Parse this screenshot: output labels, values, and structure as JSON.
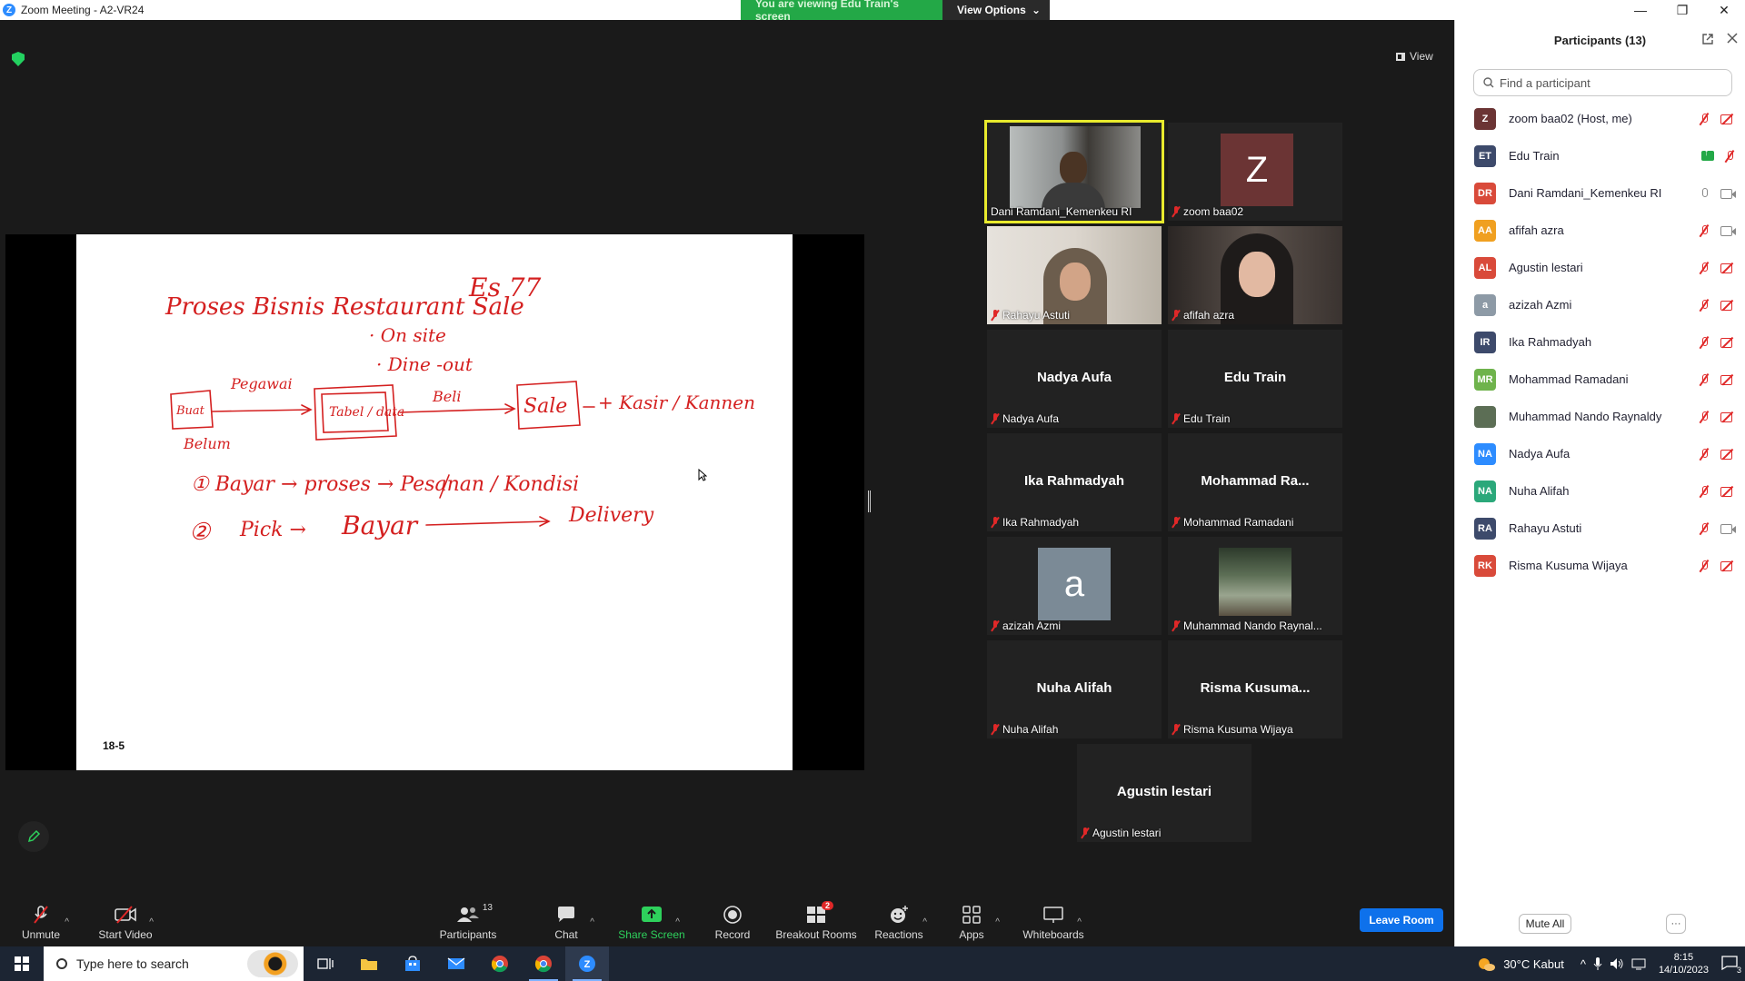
{
  "window": {
    "title": "Zoom Meeting - A2-VR24",
    "logo_letter": "Z",
    "minimize": "—",
    "restore": "❐",
    "close": "✕"
  },
  "share_banner": {
    "viewing_text": "You are viewing Edu Train's screen",
    "view_options_label": "View Options",
    "caret": "⌄"
  },
  "view_button": {
    "label": "View"
  },
  "shared_screen": {
    "slide_number": "18-5",
    "whiteboard_text": {
      "title": "Proses Bisnis Restaurant Sale",
      "es": "Es 77",
      "on_site": "· On site",
      "dine_out": "· Dine -out",
      "pegawai": "Pegawai",
      "belum": "Belum",
      "buat": "Buat",
      "tabel_box": "Tabel / data",
      "beli": "Beli",
      "sale_box": "Sale",
      "kasir": "+ Kasir / Kannen",
      "step1": "① Bayar → proses → Pesanan / Kondisi",
      "step2_num": "②",
      "step2_a": "Pick →",
      "step2_b": "Bayar",
      "step2_c": "Delivery"
    }
  },
  "video_tiles": [
    {
      "name": "Dani Ramdani_Kemenkeu RI",
      "type": "video",
      "active": true
    },
    {
      "name": "zoom baa02",
      "type": "avatar",
      "avatar_letter": "Z"
    },
    {
      "name": "Rahayu Astuti",
      "type": "video"
    },
    {
      "name": "afifah azra",
      "type": "video"
    },
    {
      "name": "Nadya Aufa",
      "type": "name",
      "big_name": "Nadya Aufa"
    },
    {
      "name": "Edu Train",
      "type": "name",
      "big_name": "Edu Train"
    },
    {
      "name": "Ika Rahmadyah",
      "type": "name",
      "big_name": "Ika Rahmadyah"
    },
    {
      "name": "Mohammad Ramadani",
      "type": "name",
      "big_name": "Mohammad  Ra..."
    },
    {
      "name": "azizah Azmi",
      "type": "avatar",
      "avatar_letter": "a"
    },
    {
      "name": "Muhammad Nando Raynal...",
      "type": "photo"
    },
    {
      "name": "Nuha Alifah",
      "type": "name",
      "big_name": "Nuha Alifah"
    },
    {
      "name": "Risma Kusuma Wijaya",
      "type": "name",
      "big_name": "Risma  Kusuma..."
    },
    {
      "name": "Agustin lestari",
      "type": "name",
      "big_name": "Agustin lestari"
    }
  ],
  "toolbar": {
    "unmute": "Unmute",
    "start_video": "Start Video",
    "participants": "Participants",
    "participants_count": "13",
    "chat": "Chat",
    "share_screen": "Share Screen",
    "record": "Record",
    "breakout_rooms": "Breakout Rooms",
    "breakout_badge": "2",
    "reactions": "Reactions",
    "apps": "Apps",
    "whiteboards": "Whiteboards",
    "caret": "^",
    "leave": "Leave Room"
  },
  "participants_panel": {
    "title": "Participants (13)",
    "search_placeholder": "Find a participant",
    "mute_all": "Mute All",
    "more": "···",
    "list": [
      {
        "initials": "Z",
        "name": "zoom baa02 (Host, me)",
        "color": "#6b3434",
        "mic": "muted",
        "cam": "off"
      },
      {
        "initials": "ET",
        "name": "Edu Train",
        "color": "#3d4a6b",
        "mic": "sharing",
        "cam": "muted"
      },
      {
        "initials": "DR",
        "name": "Dani Ramdani_Kemenkeu RI",
        "color": "#d94a3a",
        "mic": "on",
        "cam": "on"
      },
      {
        "initials": "AA",
        "name": "afifah azra",
        "color": "#f0a020",
        "mic": "muted",
        "cam": "on"
      },
      {
        "initials": "AL",
        "name": "Agustin lestari",
        "color": "#d94a3a",
        "mic": "muted",
        "cam": "off"
      },
      {
        "initials": "a",
        "name": "azizah Azmi",
        "color": "#8d9aa6",
        "mic": "muted",
        "cam": "off"
      },
      {
        "initials": "IR",
        "name": "Ika Rahmadyah",
        "color": "#3d4a6b",
        "mic": "muted",
        "cam": "off"
      },
      {
        "initials": "MR",
        "name": "Mohammad Ramadani",
        "color": "#6fb34c",
        "mic": "muted",
        "cam": "off"
      },
      {
        "initials": "",
        "name": "Muhammad Nando Raynaldy",
        "color": "#5c6e55",
        "mic": "muted",
        "cam": "off"
      },
      {
        "initials": "NA",
        "name": "Nadya Aufa",
        "color": "#2d8cff",
        "mic": "muted",
        "cam": "off"
      },
      {
        "initials": "NA",
        "name": "Nuha Alifah",
        "color": "#2ba87a",
        "mic": "muted",
        "cam": "off"
      },
      {
        "initials": "RA",
        "name": "Rahayu Astuti",
        "color": "#3d4a6b",
        "mic": "muted",
        "cam": "on"
      },
      {
        "initials": "RK",
        "name": "Risma Kusuma Wijaya",
        "color": "#d94a3a",
        "mic": "muted",
        "cam": "off"
      }
    ]
  },
  "taskbar": {
    "search_placeholder": "Type here to search",
    "weather": "30°C  Kabut",
    "time": "8:15",
    "date": "14/10/2023",
    "notification_count": "3"
  }
}
